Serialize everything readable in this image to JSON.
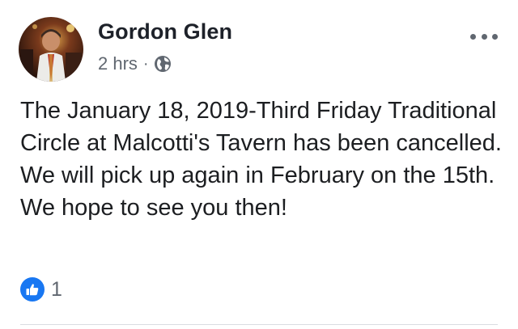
{
  "post": {
    "author": {
      "name": "Gordon Glen",
      "avatar_icon": "profile-photo"
    },
    "meta": {
      "time": "2 hrs",
      "separator": "·",
      "audience_icon": "globe-icon"
    },
    "more_icon": "more-options-icon",
    "text": "The January 18, 2019-Third Friday Traditional Circle at Malcotti's Tavern has been cancelled.  We will pick up again in February on the 15th.  We hope to see you then!",
    "reactions": {
      "icon": "like-icon",
      "count": "1"
    }
  },
  "colors": {
    "like_blue": "#1877f2",
    "meta_gray": "#606770",
    "text": "#1c1e21"
  }
}
